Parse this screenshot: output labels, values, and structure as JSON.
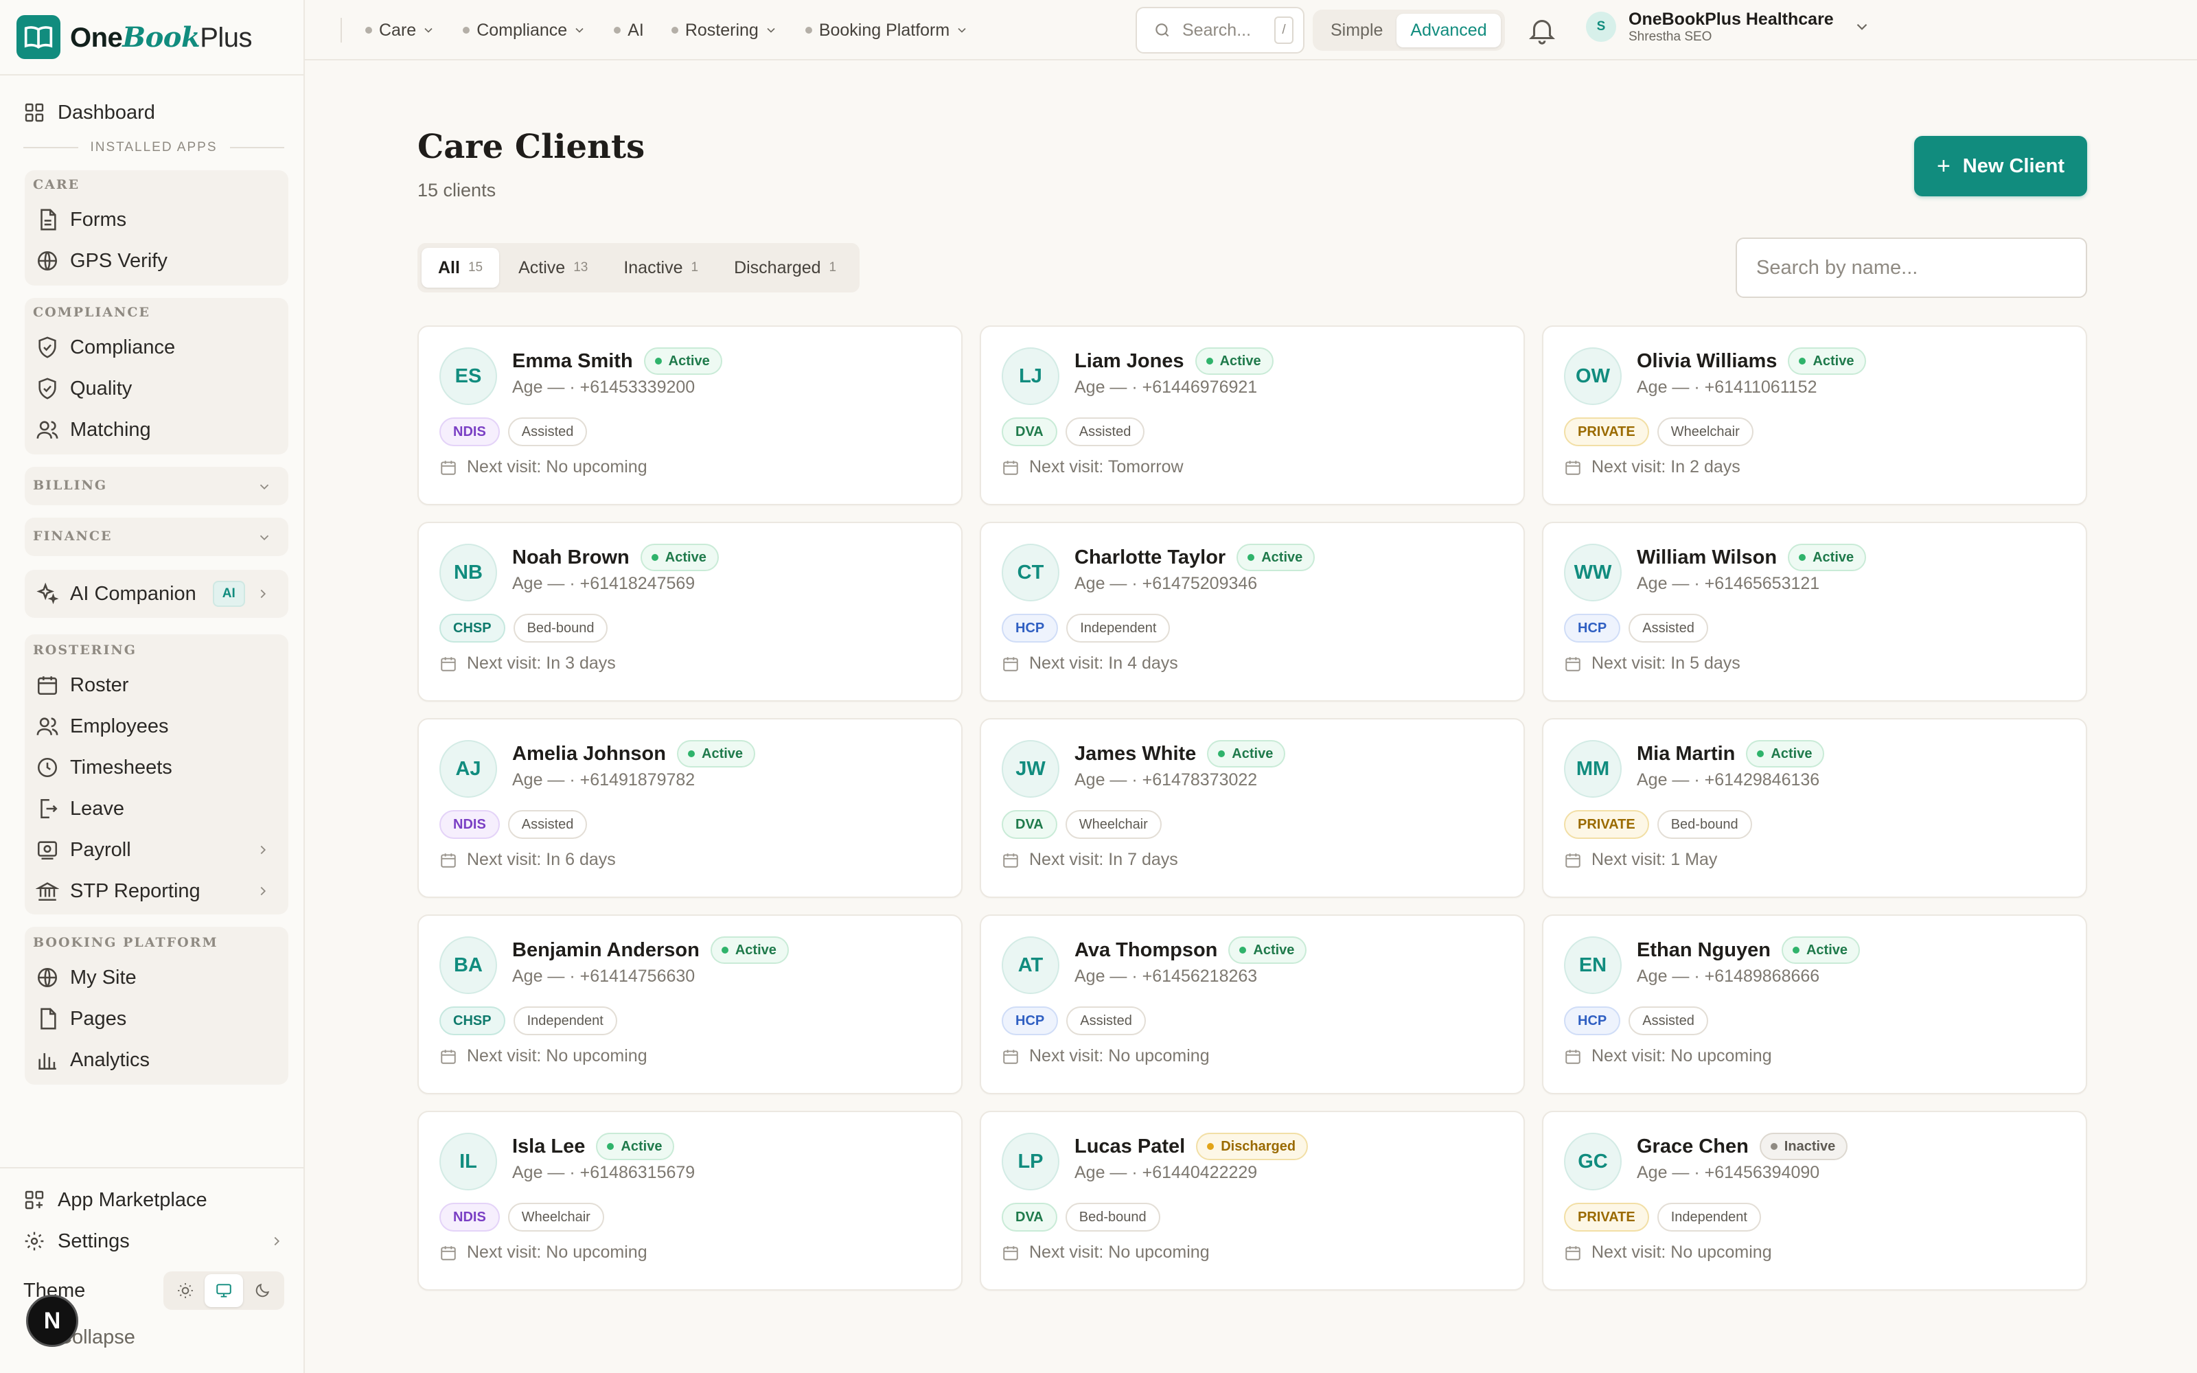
{
  "app": {
    "brand_a": "One",
    "brand_b": "Book",
    "brand_c": "Plus"
  },
  "sidebar": {
    "dashboard": "Dashboard",
    "installed_label": "INSTALLED APPS",
    "care": {
      "title": "CARE",
      "items": [
        "Forms",
        "GPS Verify"
      ]
    },
    "compliance": {
      "title": "COMPLIANCE",
      "items": [
        "Compliance",
        "Quality",
        "Matching"
      ]
    },
    "billing": "BILLING",
    "finance": "FINANCE",
    "ai_companion": "AI Companion",
    "ai_badge": "AI",
    "rostering": {
      "title": "ROSTERING",
      "items": [
        "Roster",
        "Employees",
        "Timesheets",
        "Leave",
        "Payroll",
        "STP Reporting"
      ]
    },
    "booking": {
      "title": "BOOKING PLATFORM",
      "items": [
        "My Site",
        "Pages",
        "Analytics"
      ]
    },
    "marketplace": "App Marketplace",
    "settings": "Settings",
    "theme": "Theme",
    "collapse": "Collapse",
    "n_badge": "N"
  },
  "topbar": {
    "nav": [
      "Care",
      "Compliance",
      "AI",
      "Rostering",
      "Booking Platform"
    ],
    "search_placeholder": "Search...",
    "search_shortcut": "/",
    "mode_simple": "Simple",
    "mode_advanced": "Advanced",
    "org_initial": "S",
    "org_name": "OneBookPlus Healthcare",
    "org_user": "Shrestha SEO"
  },
  "main": {
    "title": "Care Clients",
    "subtitle": "15 clients",
    "new_button": "New Client",
    "tabs": [
      {
        "label": "All",
        "count": "15"
      },
      {
        "label": "Active",
        "count": "13"
      },
      {
        "label": "Inactive",
        "count": "1"
      },
      {
        "label": "Discharged",
        "count": "1"
      }
    ],
    "search_placeholder": "Search by name..."
  },
  "status_colors": {
    "active": "#2fb36b",
    "discharged": "#e2a418",
    "inactive": "#8f8a82",
    "accent": "#118c7e"
  },
  "clients": [
    {
      "initials": "ES",
      "name": "Emma Smith",
      "status": "Active",
      "meta": "Age — · +61453339200",
      "funding": "NDIS",
      "mobility": "Assisted",
      "visit": "Next visit: No upcoming"
    },
    {
      "initials": "LJ",
      "name": "Liam Jones",
      "status": "Active",
      "meta": "Age — · +61446976921",
      "funding": "DVA",
      "mobility": "Assisted",
      "visit": "Next visit: Tomorrow"
    },
    {
      "initials": "OW",
      "name": "Olivia Williams",
      "status": "Active",
      "meta": "Age — · +61411061152",
      "funding": "PRIVATE",
      "mobility": "Wheelchair",
      "visit": "Next visit: In 2 days"
    },
    {
      "initials": "NB",
      "name": "Noah Brown",
      "status": "Active",
      "meta": "Age — · +61418247569",
      "funding": "CHSP",
      "mobility": "Bed-bound",
      "visit": "Next visit: In 3 days"
    },
    {
      "initials": "CT",
      "name": "Charlotte Taylor",
      "status": "Active",
      "meta": "Age — · +61475209346",
      "funding": "HCP",
      "mobility": "Independent",
      "visit": "Next visit: In 4 days"
    },
    {
      "initials": "WW",
      "name": "William Wilson",
      "status": "Active",
      "meta": "Age — · +61465653121",
      "funding": "HCP",
      "mobility": "Assisted",
      "visit": "Next visit: In 5 days"
    },
    {
      "initials": "AJ",
      "name": "Amelia Johnson",
      "status": "Active",
      "meta": "Age — · +61491879782",
      "funding": "NDIS",
      "mobility": "Assisted",
      "visit": "Next visit: In 6 days"
    },
    {
      "initials": "JW",
      "name": "James White",
      "status": "Active",
      "meta": "Age — · +61478373022",
      "funding": "DVA",
      "mobility": "Wheelchair",
      "visit": "Next visit: In 7 days"
    },
    {
      "initials": "MM",
      "name": "Mia Martin",
      "status": "Active",
      "meta": "Age — · +61429846136",
      "funding": "PRIVATE",
      "mobility": "Bed-bound",
      "visit": "Next visit: 1 May"
    },
    {
      "initials": "BA",
      "name": "Benjamin Anderson",
      "status": "Active",
      "meta": "Age — · +61414756630",
      "funding": "CHSP",
      "mobility": "Independent",
      "visit": "Next visit: No upcoming"
    },
    {
      "initials": "AT",
      "name": "Ava Thompson",
      "status": "Active",
      "meta": "Age — · +61456218263",
      "funding": "HCP",
      "mobility": "Assisted",
      "visit": "Next visit: No upcoming"
    },
    {
      "initials": "EN",
      "name": "Ethan Nguyen",
      "status": "Active",
      "meta": "Age — · +61489868666",
      "funding": "HCP",
      "mobility": "Assisted",
      "visit": "Next visit: No upcoming"
    },
    {
      "initials": "IL",
      "name": "Isla Lee",
      "status": "Active",
      "meta": "Age — · +61486315679",
      "funding": "NDIS",
      "mobility": "Wheelchair",
      "visit": "Next visit: No upcoming"
    },
    {
      "initials": "LP",
      "name": "Lucas Patel",
      "status": "Discharged",
      "meta": "Age — · +61440422229",
      "funding": "DVA",
      "mobility": "Bed-bound",
      "visit": "Next visit: No upcoming"
    },
    {
      "initials": "GC",
      "name": "Grace Chen",
      "status": "Inactive",
      "meta": "Age — · +61456394090",
      "funding": "PRIVATE",
      "mobility": "Independent",
      "visit": "Next visit: No upcoming"
    }
  ]
}
